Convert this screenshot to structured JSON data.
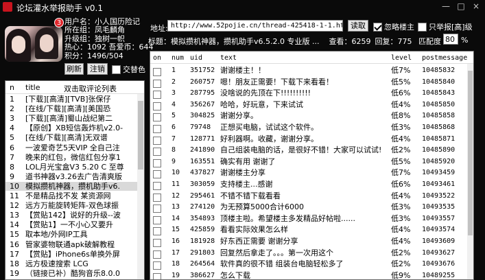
{
  "window": {
    "title": "论坛灌水举报助手  v0.1",
    "controls": [
      "—",
      "□",
      "×"
    ]
  },
  "user": {
    "badge": "3",
    "name": "用户名：小人国历险记",
    "group": "所在组：凤毛麟角",
    "upgrade_group": "升级组：独树一帜",
    "heat": "热心：1092  吾爱币：644",
    "points": "积分：1496/504"
  },
  "buttons": {
    "refresh": "刷新",
    "logout": "注销",
    "alternate_color": "交替色",
    "read": "读取",
    "ignore_op": "忽略楼主",
    "report_only_high": "只举报[高]级"
  },
  "address": {
    "label": "地址:",
    "value": "http://www.52pojie.cn/thread-425418-1-1.html"
  },
  "topic": {
    "label_title": "标题：模拟攒机神器，攒机助手v6.5.2.0 专业版 ...",
    "views": "查看：6259",
    "replies": "回复：775",
    "zoom_label": "匹配度",
    "zoom_value": "80",
    "zoom_unit": "%"
  },
  "left_list": {
    "headers": [
      "n",
      "title",
      "双击取评论列表"
    ],
    "selected_index": 9,
    "items": [
      {
        "n": "1",
        "title": "[下载][高清][TVB]张保仔"
      },
      {
        "n": "2",
        "title": "[在线/下载][高清][美国恐"
      },
      {
        "n": "3",
        "title": "[下载][高清]蜀山战纪第二"
      },
      {
        "n": "4",
        "title": "【原创】XB短信轰炸机v2.0-"
      },
      {
        "n": "5",
        "title": "[在线/下载][高清]无双谱"
      },
      {
        "n": "6",
        "title": "一波爱奇艺5天VIP 全自己注"
      },
      {
        "n": "7",
        "title": "晚来的红包，微信红包分享1"
      },
      {
        "n": "8",
        "title": "LOL月光宝盒V3 5.20 C 至尊"
      },
      {
        "n": "9",
        "title": "道书神器v3.26去广告清爽版"
      },
      {
        "n": "10",
        "title": "模拟攒机神器，攒机助手v6."
      },
      {
        "n": "11",
        "title": "不是精品找不发  某资源网"
      },
      {
        "n": "12",
        "title": "远方万能旋转矩阵-双色球振"
      },
      {
        "n": "13",
        "title": "【赏贴142】说好的升级--波"
      },
      {
        "n": "14",
        "title": "【赏贴1】一不小心又要升"
      },
      {
        "n": "15",
        "title": "取本地/外网IP工具"
      },
      {
        "n": "16",
        "title": "管家婆物联通apk破解教程"
      },
      {
        "n": "17",
        "title": "【赏贴】iPhone6s单换外屏"
      },
      {
        "n": "18",
        "title": "远方极速搜索 LCG"
      },
      {
        "n": "19",
        "title": "（链接已补）酷狗音乐8.0.0"
      }
    ]
  },
  "table": {
    "headers": [
      "on",
      "num",
      "uid",
      "text",
      "level",
      "postmessage"
    ],
    "rows": [
      {
        "num": "1",
        "uid": "351752",
        "text": "谢谢楼主！！",
        "level": "低7%",
        "pm": "10485832"
      },
      {
        "num": "2",
        "uid": "260757",
        "text": "嗯！朋友正需要！下载下来看看！",
        "level": "低5%",
        "pm": "10485840"
      },
      {
        "num": "3",
        "uid": "287795",
        "text": "没啥说的先顶在下!!!!!!!!!!",
        "level": "低6%",
        "pm": "10485843"
      },
      {
        "num": "4",
        "uid": "356267",
        "text": "哈哈，好玩意，下来试试",
        "level": "低4%",
        "pm": "10485850"
      },
      {
        "num": "5",
        "uid": "304825",
        "text": "谢谢分享。",
        "level": "低8%",
        "pm": "10485858"
      },
      {
        "num": "6",
        "uid": "79748",
        "text": "正想买电脑，试试这个软件。",
        "level": "低3%",
        "pm": "10485868"
      },
      {
        "num": "7",
        "uid": "128771",
        "text": "好利器啊。收藏，谢谢分享。",
        "level": "低4%",
        "pm": "10485871"
      },
      {
        "num": "8",
        "uid": "241890",
        "text": "自己组装电脑的话，是很好不错！大家可以试试!",
        "level": "低2%",
        "pm": "10485890"
      },
      {
        "num": "9",
        "uid": "163551",
        "text": "确实有用 谢谢了",
        "level": "低5%",
        "pm": "10485920"
      },
      {
        "num": "10",
        "uid": "437827",
        "text": "谢谢楼主分享",
        "level": "低7%",
        "pm": "10493459"
      },
      {
        "num": "11",
        "uid": "303059",
        "text": "支持楼主...感谢",
        "level": "低6%",
        "pm": "10493461"
      },
      {
        "num": "12",
        "uid": "295461",
        "text": "不错不错下载看看",
        "level": "低4%",
        "pm": "10493522"
      },
      {
        "num": "13",
        "uid": "274120",
        "text": "为无预算5000合计6000",
        "level": "低3%",
        "pm": "10493535"
      },
      {
        "num": "14",
        "uid": "354893",
        "text": "顶楼主啦。希望楼主多发精品好帖啦......",
        "level": "低3%",
        "pm": "10493557"
      },
      {
        "num": "15",
        "uid": "425859",
        "text": "看看实际效果怎么样",
        "level": "低4%",
        "pm": "10493574"
      },
      {
        "num": "16",
        "uid": "181928",
        "text": "好东西正需要 谢谢分享",
        "level": "低4%",
        "pm": "10493609"
      },
      {
        "num": "17",
        "uid": "291803",
        "text": "回复然后拿走了。。。第一次用这个",
        "level": "低2%",
        "pm": "10493627"
      },
      {
        "num": "18",
        "uid": "264564",
        "text": "软件真的很不错 组装台电脑轻松多了",
        "level": "低2%",
        "pm": "10493676"
      },
      {
        "num": "19",
        "uid": "386627",
        "text": "怎么下载",
        "level": "低9%",
        "pm": "10489255"
      },
      {
        "num": "20",
        "uid": "199999",
        "text": "谢谢分享...卖了要好用下",
        "level": "低4%",
        "pm": "10493700"
      }
    ]
  }
}
